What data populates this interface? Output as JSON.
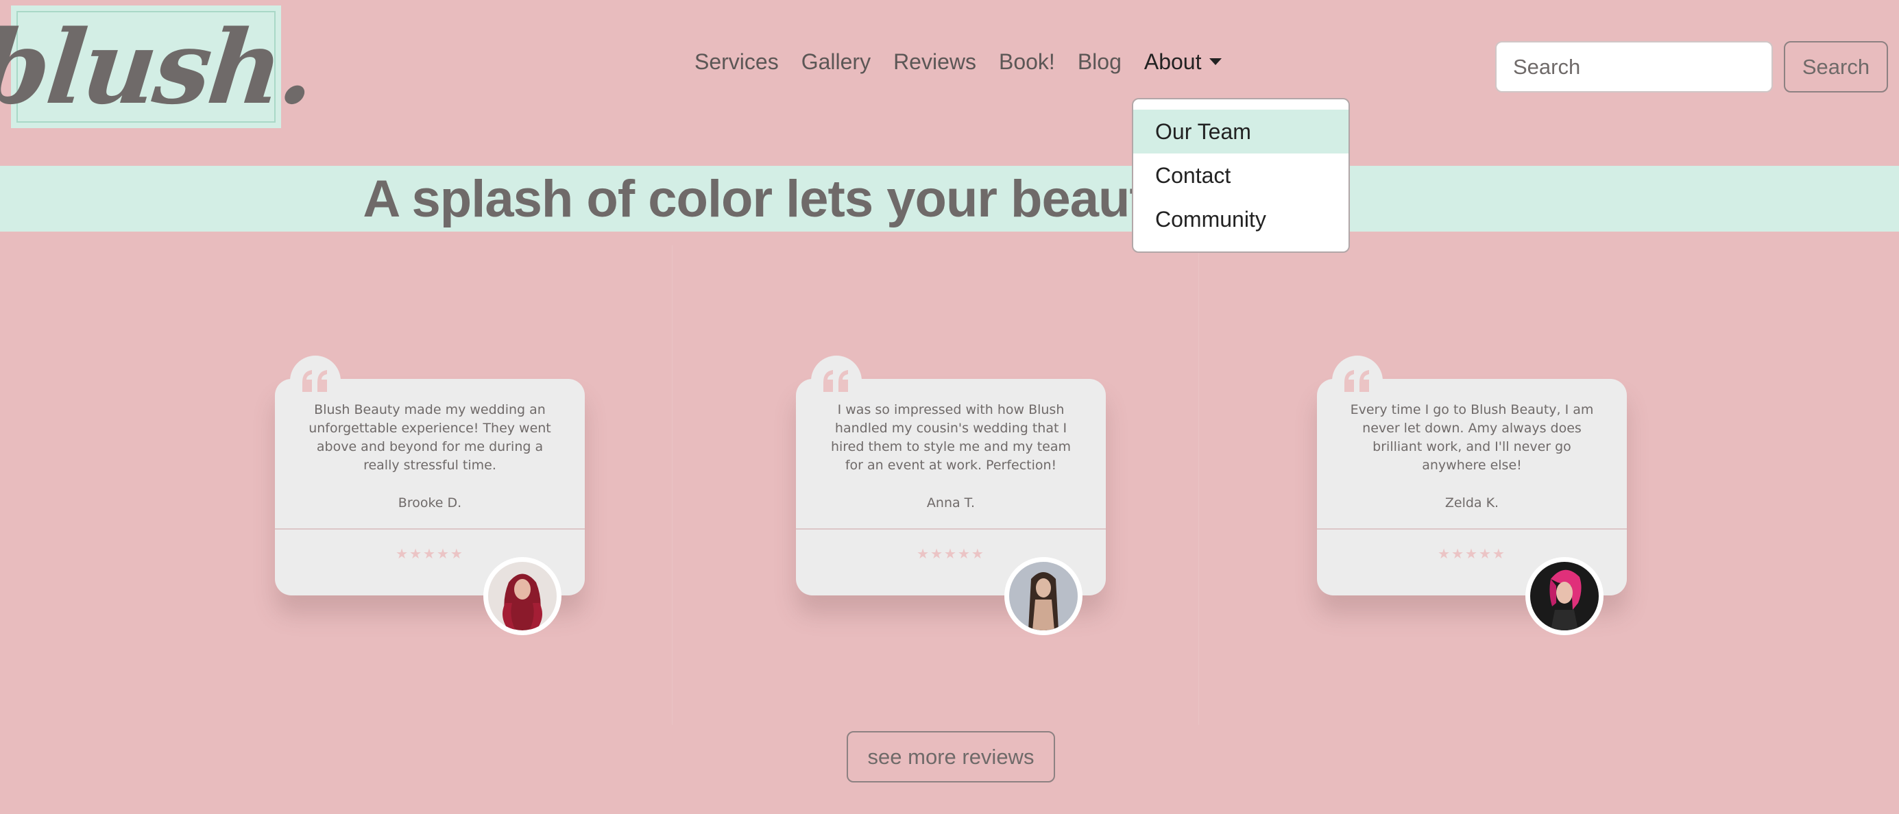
{
  "brand": {
    "logo_text": "blush."
  },
  "nav": {
    "items": [
      {
        "label": "Services"
      },
      {
        "label": "Gallery"
      },
      {
        "label": "Reviews"
      },
      {
        "label": "Book!"
      },
      {
        "label": "Blog"
      },
      {
        "label": "About"
      }
    ],
    "search": {
      "placeholder": "Search",
      "button_label": "Search"
    }
  },
  "about_dropdown": {
    "items": [
      {
        "label": "Our Team",
        "highlighted": true
      },
      {
        "label": "Contact"
      },
      {
        "label": "Community"
      }
    ]
  },
  "hero": {
    "title": "A splash of color lets your beauty shine"
  },
  "reviews": {
    "items": [
      {
        "text": "Blush Beauty made my wedding an unforgettable experience! They went above and beyond for me during a really stressful time.",
        "author": "Brooke D.",
        "rating": 5,
        "stars": "★★★★★"
      },
      {
        "text": "I was so impressed with how Blush handled my cousin's wedding that I hired them to style me and my team for an event at work. Perfection!",
        "author": "Anna T.",
        "rating": 5,
        "stars": "★★★★★"
      },
      {
        "text": "Every time I go to Blush Beauty, I am never let down. Amy always does brilliant work, and I'll never go anywhere else!",
        "author": "Zelda K.",
        "rating": 5,
        "stars": "★★★★★"
      }
    ],
    "more_label": "see more reviews"
  },
  "colors": {
    "background": "#e8bcbe",
    "mint": "#d3eee5",
    "text": "#6f6a69",
    "card": "#ececec",
    "star": "#ebc4c5"
  }
}
